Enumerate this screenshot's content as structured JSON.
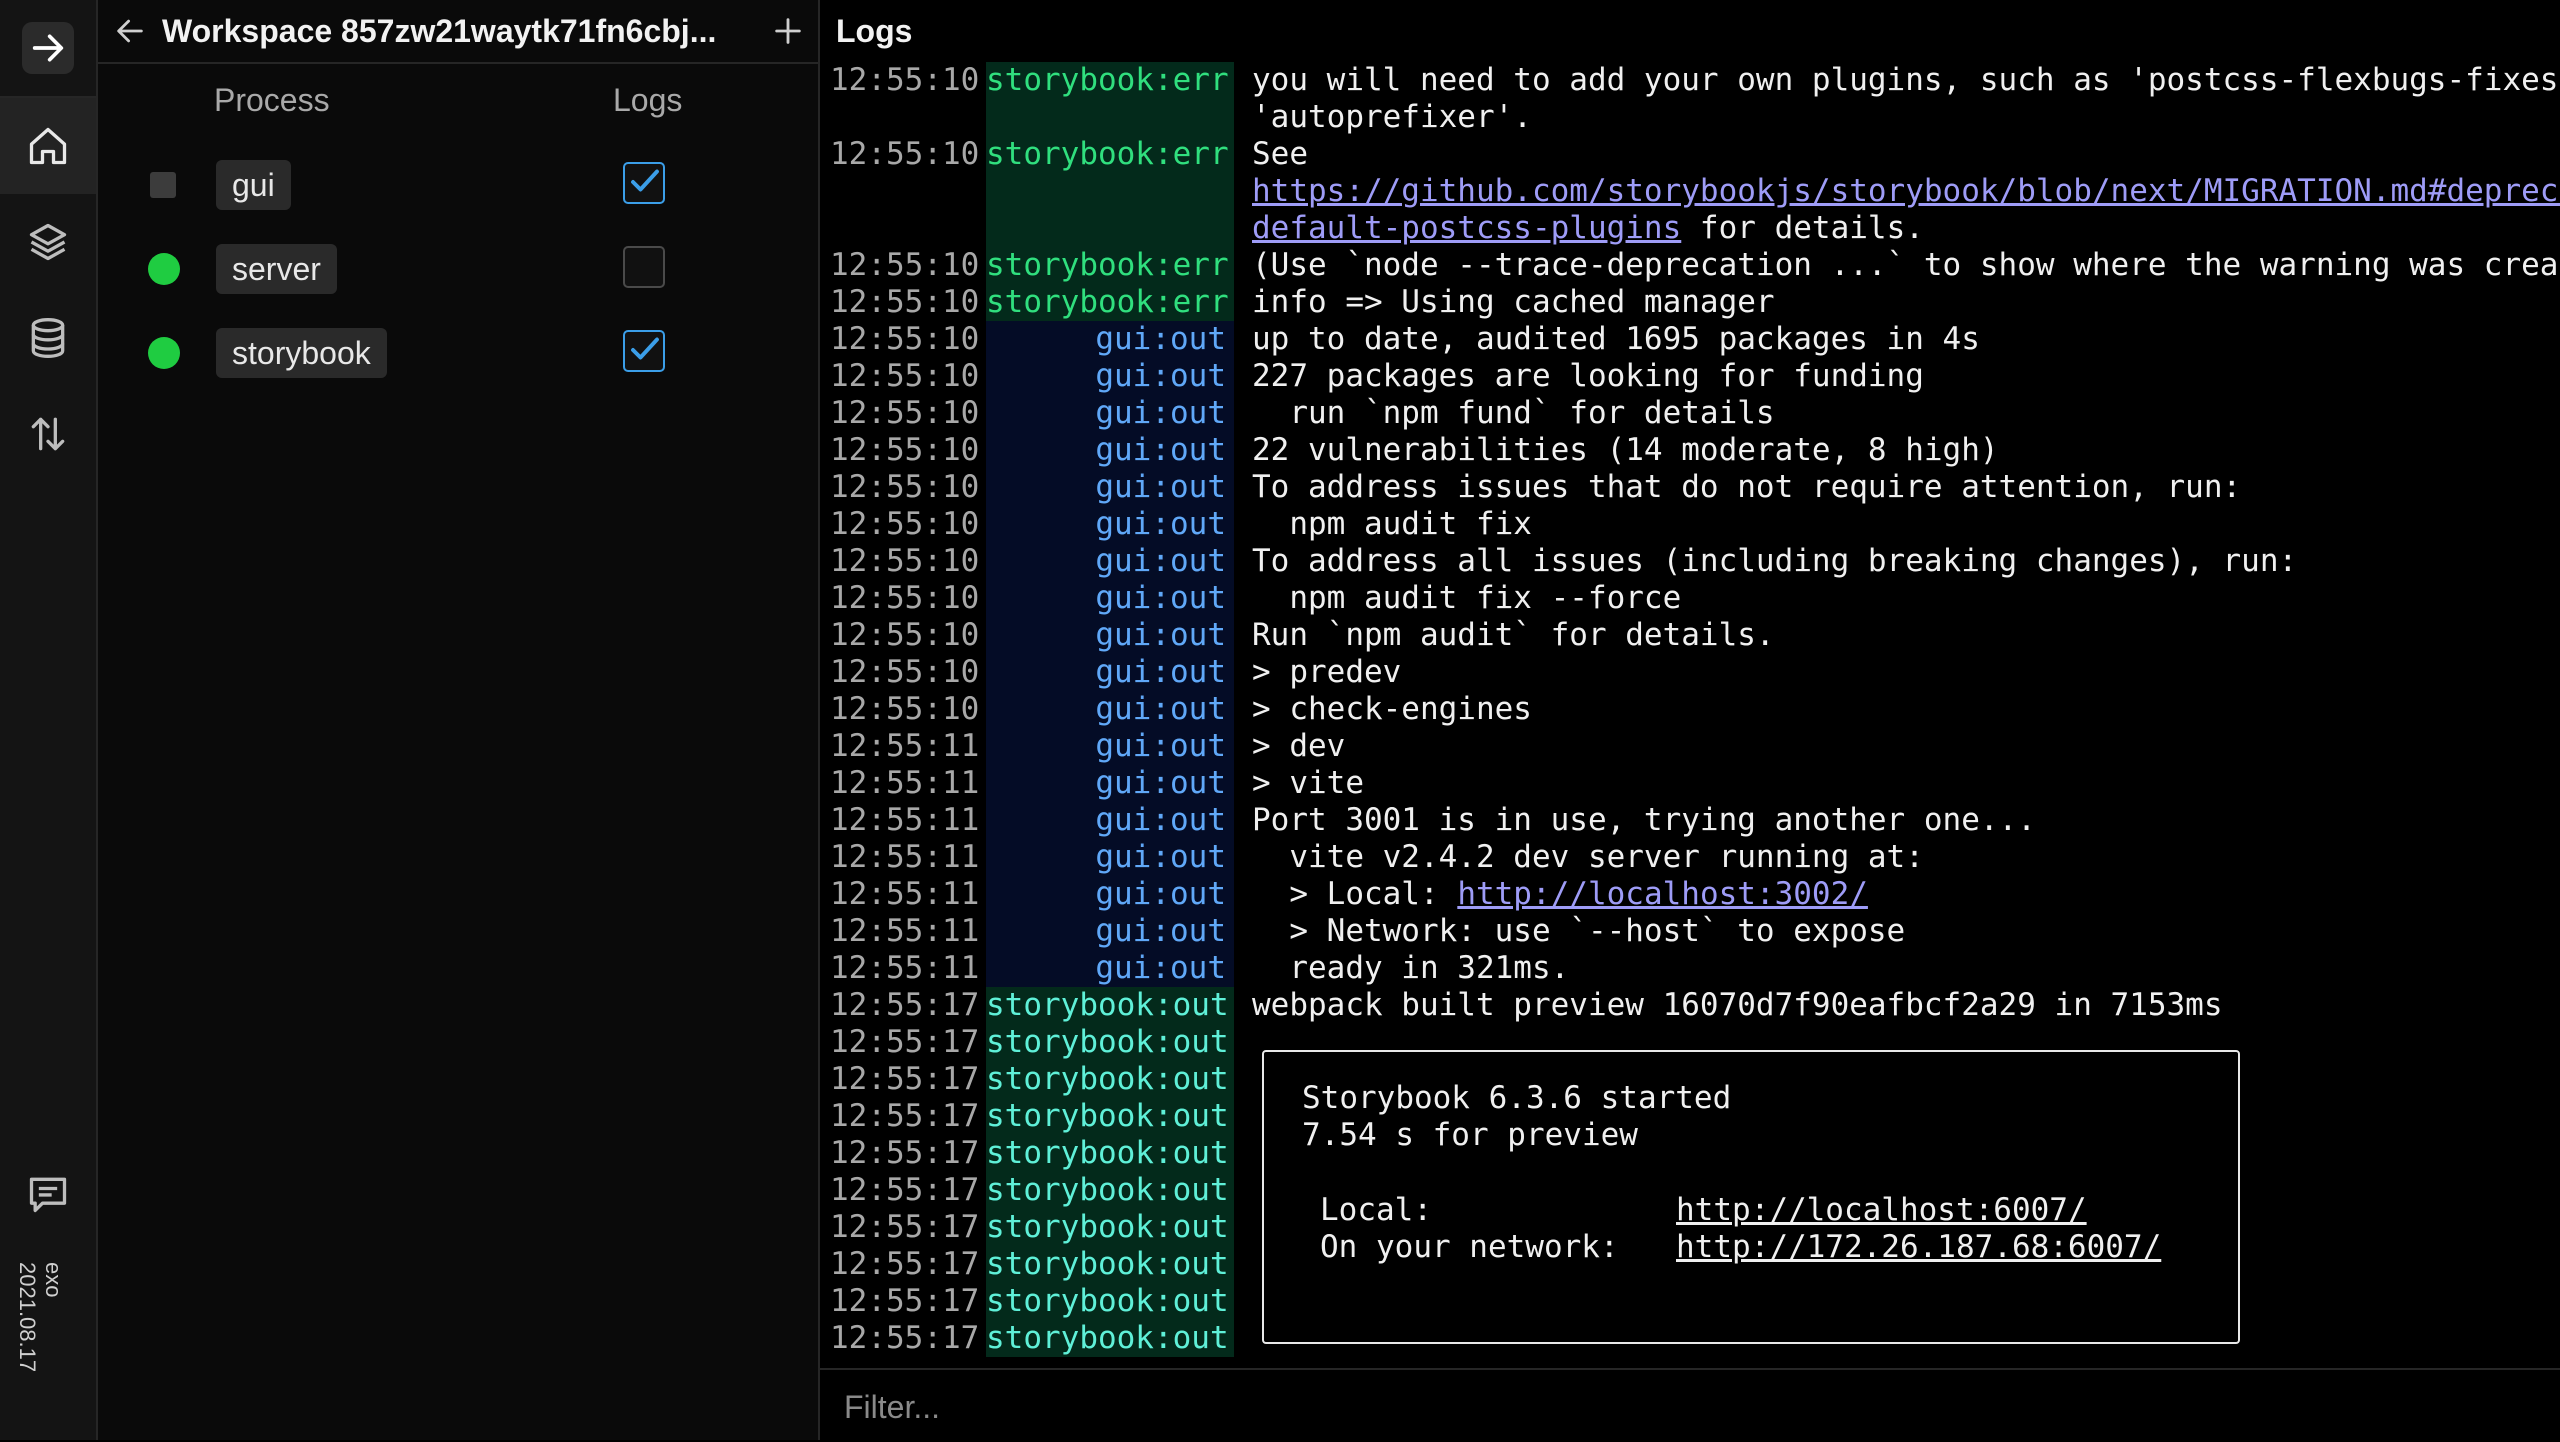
{
  "app": {
    "version": "exo 2021.08.17"
  },
  "workspace": {
    "title": "Workspace 857zw21waytk71fn6cbj...",
    "columns": {
      "process": "Process",
      "logs": "Logs"
    },
    "processes": [
      {
        "name": "gui",
        "status": "stopped",
        "logs_enabled": true
      },
      {
        "name": "server",
        "status": "running",
        "logs_enabled": false
      },
      {
        "name": "storybook",
        "status": "running",
        "logs_enabled": true
      }
    ]
  },
  "logs": {
    "title": "Logs",
    "filter_placeholder": "Filter...",
    "lines": [
      {
        "time": "12:55:10",
        "src": "storybook:err",
        "msg": "you will need to add your own plugins, such as 'postcss-flexbugs-fixes'"
      },
      {
        "time": "",
        "src": "",
        "msg": "'autoprefixer'."
      },
      {
        "time": "12:55:10",
        "src": "storybook:err",
        "msg": "See"
      },
      {
        "time": "",
        "src": "",
        "msg": "https://github.com/storybookjs/storybook/blob/next/MIGRATION.md#depreca"
      },
      {
        "time": "",
        "src": "",
        "msg": "default-postcss-plugins",
        "suffix": " for details."
      },
      {
        "time": "12:55:10",
        "src": "storybook:err",
        "msg": "(Use `node --trace-deprecation ...` to show where the warning was creat"
      },
      {
        "time": "12:55:10",
        "src": "storybook:err",
        "msg": "info => Using cached manager"
      },
      {
        "time": "12:55:10",
        "src": "gui:out",
        "msg": "up to date, audited 1695 packages in 4s"
      },
      {
        "time": "12:55:10",
        "src": "gui:out",
        "msg": "227 packages are looking for funding"
      },
      {
        "time": "12:55:10",
        "src": "gui:out",
        "msg": "  run `npm fund` for details"
      },
      {
        "time": "12:55:10",
        "src": "gui:out",
        "msg": "22 vulnerabilities (14 moderate, 8 high)"
      },
      {
        "time": "12:55:10",
        "src": "gui:out",
        "msg": "To address issues that do not require attention, run:"
      },
      {
        "time": "12:55:10",
        "src": "gui:out",
        "msg": "  npm audit fix"
      },
      {
        "time": "12:55:10",
        "src": "gui:out",
        "msg": "To address all issues (including breaking changes), run:"
      },
      {
        "time": "12:55:10",
        "src": "gui:out",
        "msg": "  npm audit fix --force"
      },
      {
        "time": "12:55:10",
        "src": "gui:out",
        "msg": "Run `npm audit` for details."
      },
      {
        "time": "12:55:10",
        "src": "gui:out",
        "msg": "> predev"
      },
      {
        "time": "12:55:10",
        "src": "gui:out",
        "msg": "> check-engines"
      },
      {
        "time": "12:55:11",
        "src": "gui:out",
        "msg": "> dev"
      },
      {
        "time": "12:55:11",
        "src": "gui:out",
        "msg": "> vite"
      },
      {
        "time": "12:55:11",
        "src": "gui:out",
        "msg": "Port 3001 is in use, trying another one..."
      },
      {
        "time": "12:55:11",
        "src": "gui:out",
        "msg": "  vite v2.4.2 dev server running at:"
      },
      {
        "time": "12:55:11",
        "src": "gui:out",
        "msg": "  > Local: ",
        "link": "http://localhost:3002/"
      },
      {
        "time": "12:55:11",
        "src": "gui:out",
        "msg": "  > Network: use `--host` to expose"
      },
      {
        "time": "12:55:11",
        "src": "gui:out",
        "msg": "  ready in 321ms."
      },
      {
        "time": "12:55:17",
        "src": "storybook:out",
        "msg": "webpack built preview 16070d7f90eafbcf2a29 in 7153ms"
      },
      {
        "time": "12:55:17",
        "src": "storybook:out",
        "msg": ""
      },
      {
        "time": "12:55:17",
        "src": "storybook:out",
        "msg": ""
      },
      {
        "time": "12:55:17",
        "src": "storybook:out",
        "msg": ""
      },
      {
        "time": "12:55:17",
        "src": "storybook:out",
        "msg": ""
      },
      {
        "time": "12:55:17",
        "src": "storybook:out",
        "msg": ""
      },
      {
        "time": "12:55:17",
        "src": "storybook:out",
        "msg": ""
      },
      {
        "time": "12:55:17",
        "src": "storybook:out",
        "msg": ""
      },
      {
        "time": "12:55:17",
        "src": "storybook:out",
        "msg": ""
      },
      {
        "time": "12:55:17",
        "src": "storybook:out",
        "msg": ""
      }
    ],
    "storybook_box": {
      "started": "Storybook 6.3.6 started",
      "preview": "7.54 s for preview",
      "local_label": "Local:",
      "local_url": "http://localhost:6007/",
      "network_label": "On your network:",
      "network_url": "http://172.26.187.68:6007/"
    }
  },
  "colors": {
    "storybook_err": "#30df7e",
    "storybook_out": "#5ff0d8",
    "gui_out": "#60a8f8",
    "running": "#1fcc41",
    "checkbox": "#3b9ee8",
    "link": "#9e9cf7"
  },
  "icons": {
    "logo": "arrow-right-icon",
    "nav": [
      "home-icon",
      "layers-icon",
      "database-icon",
      "transfer-arrows-icon"
    ],
    "feedback": "message-icon"
  }
}
